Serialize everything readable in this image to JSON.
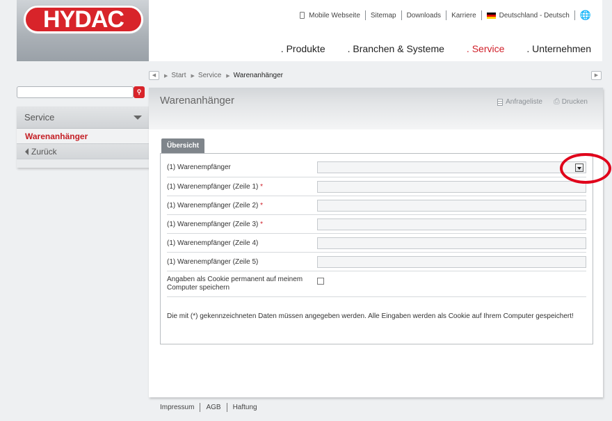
{
  "brand": {
    "logo_text": "HYDAC",
    "accent": "#d8242a"
  },
  "topnav": {
    "mobile": "Mobile Webseite",
    "sitemap": "Sitemap",
    "downloads": "Downloads",
    "karriere": "Karriere",
    "language": "Deutschland - Deutsch"
  },
  "mainnav": {
    "produkte": ". Produkte",
    "branchen": ". Branchen & Systeme",
    "service": ". Service",
    "unternehmen": ". Unternehmen"
  },
  "breadcrumb": {
    "start": "Start",
    "service": "Service",
    "current": "Warenanhänger"
  },
  "search": {
    "value": "",
    "placeholder": ""
  },
  "sidebar": {
    "section": "Service",
    "active_item": "Warenanhänger",
    "back": "Zurück"
  },
  "page": {
    "title": "Warenanhänger",
    "tool_list": "Anfrageliste",
    "tool_print": "Drucken",
    "tab": "Übersicht"
  },
  "form": {
    "rows": [
      {
        "label": "(1) Warenempfänger",
        "required": ""
      },
      {
        "label": "(1) Warenempfänger (Zeile 1)",
        "required": "*"
      },
      {
        "label": "(1) Warenempfänger (Zeile 2)",
        "required": "*"
      },
      {
        "label": "(1) Warenempfänger (Zeile 3)",
        "required": "*"
      },
      {
        "label": "(1) Warenempfänger (Zeile 4)",
        "required": ""
      },
      {
        "label": "(1) Warenempfänger (Zeile 5)",
        "required": ""
      }
    ],
    "select_value": "",
    "cookie_label": "Angaben als Cookie permanent auf meinem Computer speichern",
    "note": "Die mit (*) gekennzeichneten Daten müssen angegeben werden. Alle Eingaben werden als Cookie auf Ihrem Computer gespeichert!"
  },
  "footer": {
    "impressum": "Impressum",
    "agb": "AGB",
    "haftung": "Haftung"
  },
  "icons": [
    "phone-icon",
    "flag-de-icon",
    "globe-icon",
    "search-icon",
    "chevron-down-icon",
    "back-arrow-icon",
    "list-icon",
    "print-icon",
    "dropdown-arrow-icon"
  ]
}
